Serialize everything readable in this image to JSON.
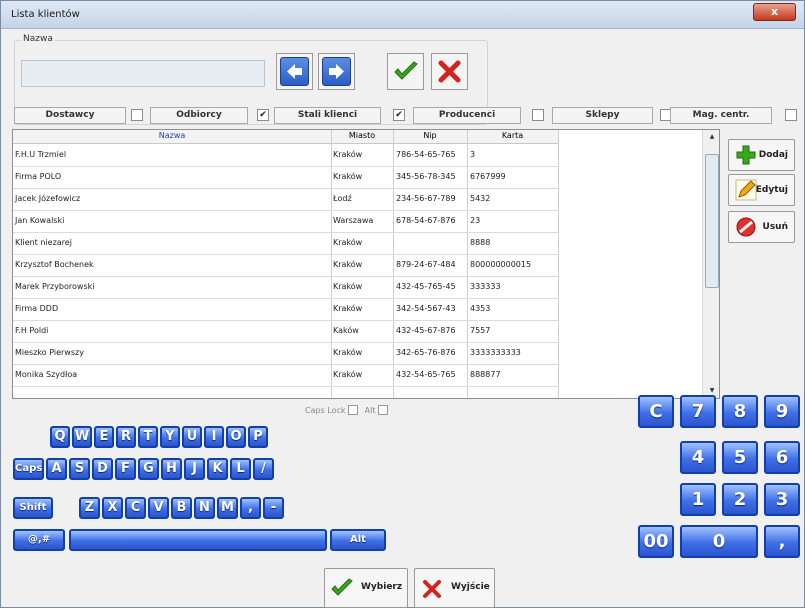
{
  "window": {
    "title": "Lista klientów",
    "close_label": "x"
  },
  "search": {
    "group_label": "Nazwa",
    "value": ""
  },
  "categories": [
    {
      "label": "Dostawcy",
      "checked": false
    },
    {
      "label": "Odbiorcy",
      "checked": true
    },
    {
      "label": "Stali klienci",
      "checked": true
    },
    {
      "label": "Producenci",
      "checked": false
    },
    {
      "label": "Sklepy",
      "checked": false
    },
    {
      "label": "Mag. centr.",
      "checked": false
    }
  ],
  "check_mark": "✔",
  "table": {
    "headers": [
      "Nazwa",
      "Miasto",
      "Nip",
      "Karta"
    ],
    "rows": [
      [
        "F.H.U Trzmiel",
        "Kraków",
        "786-54-65-765",
        "3"
      ],
      [
        "Firma POLO",
        "Kraków",
        "345-56-78-345",
        "6767999"
      ],
      [
        "Jacek Józefowicz",
        "Łodź",
        "234-56-67-789",
        "5432"
      ],
      [
        "Jan Kowalski",
        "Warszawa",
        "678-54-67-876",
        "23"
      ],
      [
        "Klient niezarej",
        "Kraków",
        "",
        "8888"
      ],
      [
        "Krzysztof Bochenek",
        "Kraków",
        "879-24-67-484",
        "800000000015"
      ],
      [
        "Marek Przyborowski",
        "Kraków",
        "432-45-765-45",
        "333333"
      ],
      [
        "Firma DDD",
        "Kraków",
        "342-54-567-43",
        "4353"
      ],
      [
        "F.H Poldi",
        "Kaków",
        "432-45-67-876",
        "7557"
      ],
      [
        "Mieszko Pierwszy",
        "Kraków",
        "342-65-76-876",
        "3333333333"
      ],
      [
        "Monika Szydłoa",
        "Kraków",
        "432-54-65-765",
        "888877"
      ]
    ]
  },
  "actions": {
    "add": "Dodaj",
    "edit": "Edytuj",
    "delete": "Usuń"
  },
  "keyboard": {
    "caps_lock_label": "Caps Lock",
    "alt_label": "Alt",
    "row1": [
      "Q",
      "W",
      "E",
      "R",
      "T",
      "Y",
      "U",
      "I",
      "O",
      "P"
    ],
    "row2": [
      "Caps",
      "A",
      "S",
      "D",
      "F",
      "G",
      "H",
      "J",
      "K",
      "L",
      "/"
    ],
    "row3": [
      "Shift",
      "Z",
      "X",
      "C",
      "V",
      "B",
      "N",
      "M",
      ",",
      "-"
    ],
    "row4": [
      "@,#",
      "",
      "Alt"
    ]
  },
  "numpad": {
    "row1": [
      "C",
      "7",
      "8",
      "9"
    ],
    "row2": [
      "4",
      "5",
      "6"
    ],
    "row3": [
      "1",
      "2",
      "3"
    ],
    "row4": [
      "00",
      "0",
      ","
    ]
  },
  "footer": {
    "select": "Wybierz",
    "exit": "Wyjście"
  },
  "colors": {
    "accent_blue": "#2b5ec8",
    "confirm_green": "#3aa81e",
    "cancel_red": "#d2231c"
  }
}
